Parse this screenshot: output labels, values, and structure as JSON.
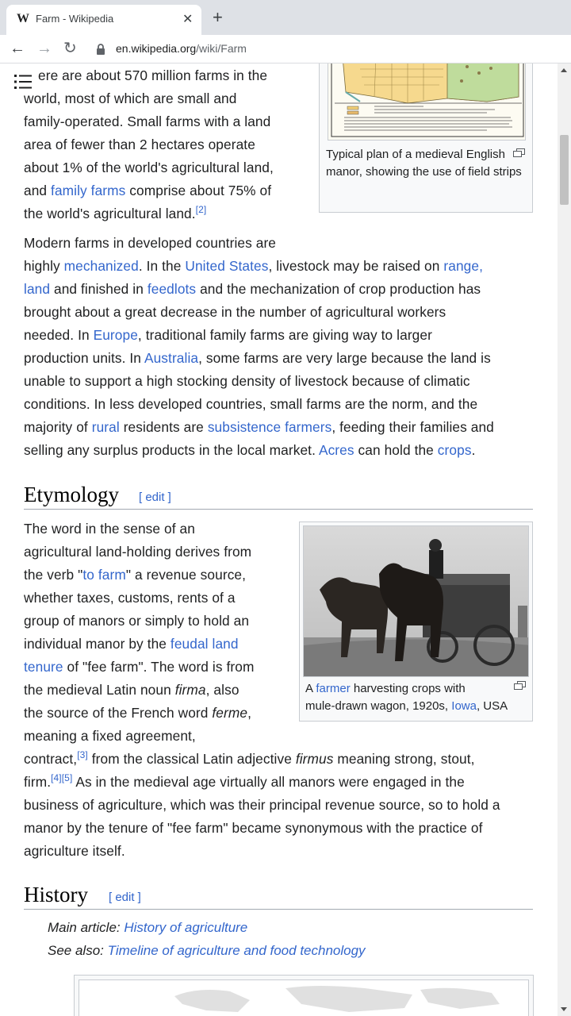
{
  "browser": {
    "tab_title": "Farm - Wikipedia",
    "tab_favicon": "W",
    "url_host": "en.wikipedia.org",
    "url_path": "/wiki/Farm"
  },
  "intro": {
    "para1": {
      "l1": "ere are about 570 million farms in the",
      "l2": "world, most of which are small and",
      "l3": "family-operated. Small farms with a land",
      "l4": "area of fewer than 2 hectares operate",
      "l5": "about 1% of the world's agricultural land,",
      "l6_a": "and ",
      "l6_link": "family farms",
      "l6_b": " comprise about 75% of",
      "l7": "the world's agricultural land.",
      "ref": "[2]"
    },
    "figure1_caption": "Typical plan of a medieval English manor, showing the use of field strips",
    "para2": {
      "l1": "Modern farms in developed countries are",
      "l2_a": "highly ",
      "l2_link1": "mechanized",
      "l2_b": ". In the ",
      "l2_link2": "United States",
      "l2_c": ", livestock may be raised on ",
      "l2_link3": "range,",
      "l3_link": "land",
      "l3_a": " and finished in ",
      "l3_link2": "feedlots",
      "l3_b": " and the mechanization of crop production has",
      "l4": "brought about a great decrease in the number of agricultural workers",
      "l5_a": "needed. In ",
      "l5_link": "Europe",
      "l5_b": ", traditional family farms are giving way to larger",
      "l6_a": "production units. In ",
      "l6_link": "Australia",
      "l6_b": ", some farms are very large because the land is",
      "l7": "unable to support a high stocking density of livestock because of climatic",
      "l8": "conditions. In less developed countries, small farms are the norm, and the",
      "l9_a": "majority of ",
      "l9_link": "rural",
      "l9_b": " residents are ",
      "l9_link2": "subsistence farmers",
      "l9_c": ", feeding their families and",
      "l10_a": "selling any surplus products in the local market. ",
      "l10_link": "Acres",
      "l10_b": " can hold the ",
      "l10_link2": "crops",
      "l10_c": "."
    }
  },
  "etymology": {
    "heading": "Etymology",
    "edit": "[ edit ]",
    "l1": "The word in the sense of an",
    "l2": "agricultural land-holding derives from",
    "l3_a": "the verb \"",
    "l3_link": "to farm",
    "l3_b": "\" a revenue source,",
    "l4": "whether taxes, customs, rents of a",
    "l5": "group of manors or simply to hold an",
    "l6_a": "individual manor by the ",
    "l6_link": "feudal land",
    "l7_link": "tenure",
    "l7_b": " of \"fee farm\". The word is from",
    "l8_a": "the medieval Latin noun ",
    "l8_i": "firma",
    "l8_b": ", also",
    "l9_a": "the source of the French word ",
    "l9_i": "ferme",
    "l9_b": ",",
    "l10": "meaning a fixed agreement,",
    "l11_a": "contract,",
    "l11_ref": "[3]",
    "l11_b": " from the classical Latin adjective ",
    "l11_i": "firmus",
    "l11_c": " meaning strong, stout,",
    "l12_a": "firm.",
    "l12_ref": "[4][5]",
    "l12_b": " As in the medieval age virtually all manors were engaged in the",
    "l13": "business of agriculture, which was their principal revenue source, so to hold a",
    "l14": "manor by the tenure of \"fee farm\" became synonymous with the practice of",
    "l15": "agriculture itself.",
    "figure2": {
      "cap_a": "A ",
      "cap_link1": "farmer",
      "cap_b": " harvesting crops with",
      "cap_c": "mule-drawn wagon, 1920s, ",
      "cap_link2": "Iowa",
      "cap_d": ", USA"
    }
  },
  "history": {
    "heading": "History",
    "edit": "[ edit ]",
    "main_label": "Main article: ",
    "main_link": "History of agriculture",
    "see_label": "See also: ",
    "see_link": "Timeline of agriculture and food technology"
  }
}
